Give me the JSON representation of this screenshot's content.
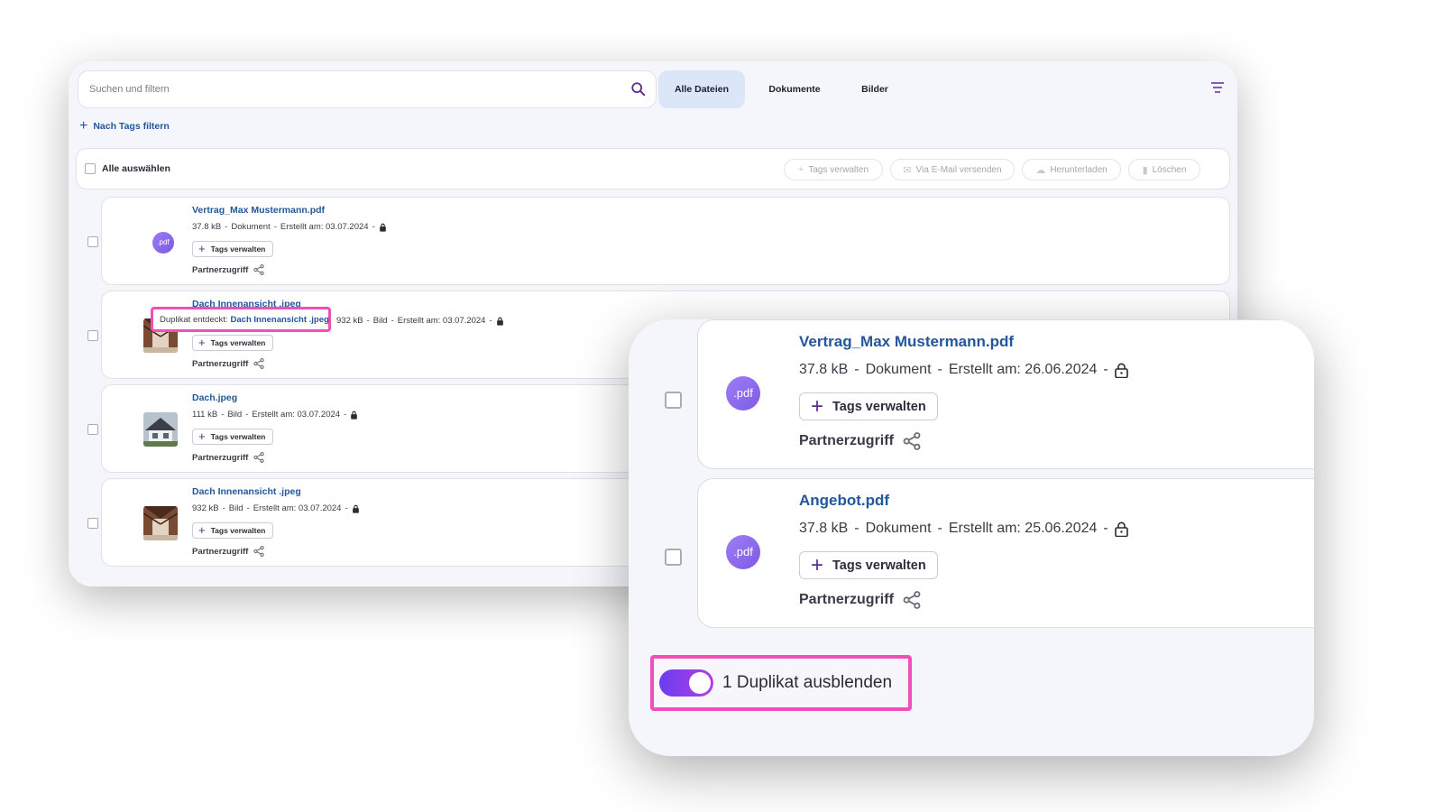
{
  "search": {
    "placeholder": "Suchen und filtern"
  },
  "tabs": [
    {
      "label": "Alle Dateien",
      "active": true
    },
    {
      "label": "Dokumente",
      "active": false
    },
    {
      "label": "Bilder",
      "active": false
    }
  ],
  "tag_filter": {
    "label": "Nach Tags filtern"
  },
  "select_bar": {
    "select_all": "Alle auswählen",
    "actions": [
      "Tags verwalten",
      "Via E-Mail versenden",
      "Herunterladen",
      "Löschen"
    ]
  },
  "files": [
    {
      "name": "Vertrag_Max Mustermann.pdf",
      "size": "37.8 kB",
      "kind": "Dokument",
      "created": "Erstellt am: 03.07.2024",
      "badge": ".pdf",
      "tags_label": "Tags verwalten",
      "partner_label": "Partnerzugriff"
    },
    {
      "name": "Dach Innenansicht .jpeg",
      "size": "932 kB",
      "kind": "Bild",
      "created": "Erstellt am: 03.07.2024",
      "duplicate_prefix": "Duplikat entdeckt:",
      "duplicate_name": "Dach Innenansicht .jpeg",
      "tags_label": "Tags verwalten",
      "partner_label": "Partnerzugriff"
    },
    {
      "name": "Dach.jpeg",
      "size": "111 kB",
      "kind": "Bild",
      "created": "Erstellt am: 03.07.2024",
      "tags_label": "Tags verwalten",
      "partner_label": "Partnerzugriff"
    },
    {
      "name": "Dach Innenansicht .jpeg",
      "size": "932 kB",
      "kind": "Bild",
      "created": "Erstellt am: 03.07.2024",
      "tags_label": "Tags verwalten",
      "partner_label": "Partnerzugriff"
    }
  ],
  "separator": "-",
  "zoom": {
    "files": [
      {
        "name": "Vertrag_Max Mustermann.pdf",
        "size": "37.8 kB",
        "kind": "Dokument",
        "created": "Erstellt am: 26.06.2024",
        "badge": ".pdf",
        "tags_label": "Tags verwalten",
        "partner_label": "Partnerzugriff"
      },
      {
        "name": "Angebot.pdf",
        "size": "37.8 kB",
        "kind": "Dokument",
        "created": "Erstellt am: 25.06.2024",
        "badge": ".pdf",
        "tags_label": "Tags verwalten",
        "partner_label": "Partnerzugriff"
      }
    ],
    "toggle": {
      "label": "1 Duplikat ausblenden",
      "on": true
    }
  },
  "colors": {
    "accent": "#f04fba",
    "link": "#24569a",
    "pdf_badge": "#8a68ec",
    "toggle": "#7a3cf0"
  }
}
